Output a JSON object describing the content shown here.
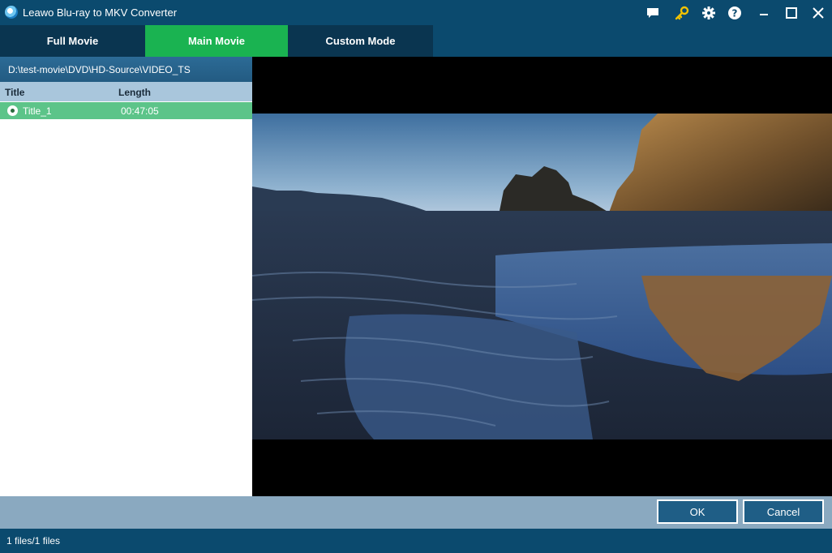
{
  "window": {
    "title": "Leawo Blu-ray to MKV Converter",
    "icons": [
      "chat-icon",
      "key-icon",
      "gear-icon",
      "help-icon",
      "minimize-icon",
      "maximize-icon",
      "close-icon"
    ],
    "colors": {
      "background": "#0b4a6e",
      "active_tab": "#1ab351",
      "selected_row": "#5cc489",
      "key_icon": "#f2c200"
    }
  },
  "tabs": [
    {
      "label": "Full Movie",
      "active": false
    },
    {
      "label": "Main Movie",
      "active": true
    },
    {
      "label": "Custom Mode",
      "active": false
    }
  ],
  "source": {
    "path": "D:\\test-movie\\DVD\\HD-Source\\VIDEO_TS"
  },
  "table": {
    "columns": [
      "Title",
      "Length"
    ],
    "rows": [
      {
        "title": "Title_1",
        "length": "00:47:05",
        "selected": true
      }
    ]
  },
  "buttons": {
    "ok": "OK",
    "cancel": "Cancel"
  },
  "status": {
    "text": "1 files/1 files"
  }
}
